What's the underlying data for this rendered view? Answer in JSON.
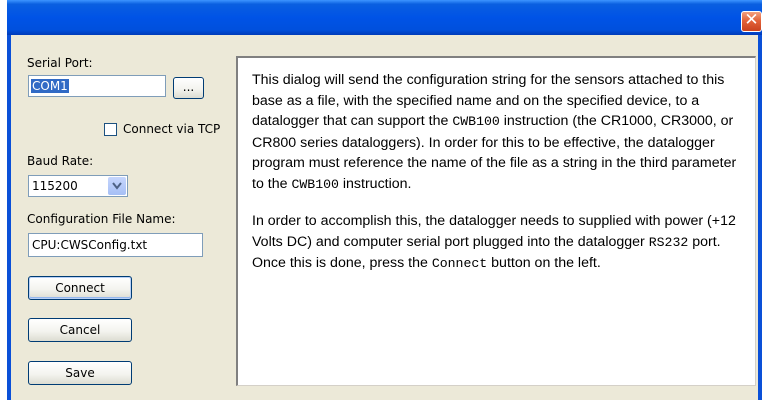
{
  "titlebar": {
    "title": "",
    "close_glyph": "✕",
    "color": "#0053e6"
  },
  "form": {
    "serial_port_label": "Serial Port:",
    "serial_port_value": "COM1",
    "browse_label": "...",
    "tcp_label": "Connect via TCP",
    "tcp_checked": false,
    "baud_label": "Baud Rate:",
    "baud_value": "115200",
    "config_file_label": "Configuration File Name:",
    "config_file_value": "CPU:CWSConfig.txt"
  },
  "buttons": {
    "connect": "Connect",
    "cancel": "Cancel",
    "save": "Save"
  },
  "help": {
    "p1": [
      {
        "text": "This dialog will send the configuration string for the sensors attached to this base as a file, with the specified name and on the specified device, to a datalogger that can support the ",
        "mono": false
      },
      {
        "text": "CWB100",
        "mono": true
      },
      {
        "text": " instruction (the CR1000, CR3000, or CR800 series dataloggers). In order for this to be effective, the datalogger program must reference the name of the file as a string in the third parameter to the ",
        "mono": false
      },
      {
        "text": "CWB100",
        "mono": true
      },
      {
        "text": " instruction.",
        "mono": false
      }
    ],
    "p2": [
      {
        "text": "In order to accomplish this, the datalogger needs to supplied with power (+12 Volts DC) and computer serial port plugged into the datalogger ",
        "mono": false
      },
      {
        "text": "RS232",
        "mono": true
      },
      {
        "text": " port. Once this is done, press the ",
        "mono": false
      },
      {
        "text": "Connect",
        "mono": true
      },
      {
        "text": " button on the left.",
        "mono": false
      }
    ]
  }
}
